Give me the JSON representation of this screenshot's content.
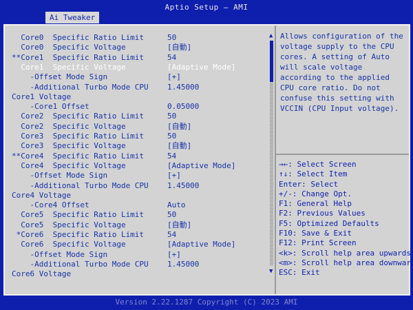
{
  "app_title": "Aptio Setup – AMI",
  "tab": "Ai Tweaker",
  "settings": [
    {
      "label": "  Core0  Specific Ratio Limit",
      "value": "50"
    },
    {
      "label": "  Core0  Specific Voltage",
      "value": "[自動]"
    },
    {
      "label": "**Core1  Specific Ratio Limit",
      "value": "54"
    },
    {
      "label": "  Core1  Specific Voltage",
      "value": "[Adaptive Mode]",
      "highlighted": true
    },
    {
      "label": "    -Offset Mode Sign",
      "value": "[+]"
    },
    {
      "label": "    -Additional Turbo Mode CPU",
      "value": "1.45000"
    },
    {
      "label": "Core1 Voltage",
      "value": ""
    },
    {
      "label": "    -Core1 Offset",
      "value": "0.05000"
    },
    {
      "label": "  Core2  Specific Ratio Limit",
      "value": "50"
    },
    {
      "label": "  Core2  Specific Voltage",
      "value": "[自動]"
    },
    {
      "label": "  Core3  Specific Ratio Limit",
      "value": "50"
    },
    {
      "label": "  Core3  Specific Voltage",
      "value": "[自動]"
    },
    {
      "label": "**Core4  Specific Ratio Limit",
      "value": "54"
    },
    {
      "label": "  Core4  Specific Voltage",
      "value": "[Adaptive Mode]"
    },
    {
      "label": "    -Offset Mode Sign",
      "value": "[+]"
    },
    {
      "label": "    -Additional Turbo Mode CPU",
      "value": "1.45000"
    },
    {
      "label": "Core4 Voltage",
      "value": ""
    },
    {
      "label": "    -Core4 Offset",
      "value": "Auto"
    },
    {
      "label": "  Core5  Specific Ratio Limit",
      "value": "50"
    },
    {
      "label": "  Core5  Specific Voltage",
      "value": "[自動]"
    },
    {
      "label": " *Core6  Specific Ratio Limit",
      "value": "54"
    },
    {
      "label": "  Core6  Specific Voltage",
      "value": "[Adaptive Mode]"
    },
    {
      "label": "    -Offset Mode Sign",
      "value": "[+]"
    },
    {
      "label": "    -Additional Turbo Mode CPU",
      "value": "1.45000"
    },
    {
      "label": "Core6 Voltage",
      "value": ""
    }
  ],
  "help_text": "Allows configuration of the voltage supply to the CPU cores. A setting of Auto will scale voltage according to the applied CPU core ratio.  Do not confuse this setting with VCCIN (CPU Input voltage).",
  "keys": [
    "→←: Select Screen",
    "↑↓: Select Item",
    "Enter: Select",
    "+/-: Change Opt.",
    "F1: General Help",
    "F2: Previous Values",
    "F5: Optimized Defaults",
    "F10: Save & Exit",
    "F12: Print Screen",
    "<k>: Scroll help area upwards",
    "<m>: Scroll help area downwards",
    "ESC: Exit"
  ],
  "scroll": {
    "up": "▲",
    "down": "▼"
  },
  "footer": "Version 2.22.1287 Copyright (C) 2023 AMI",
  "colors": {
    "background": "#0e1fae",
    "panel": "#d3d3d3",
    "text": "#1833a8",
    "highlight": "#ffffff"
  }
}
